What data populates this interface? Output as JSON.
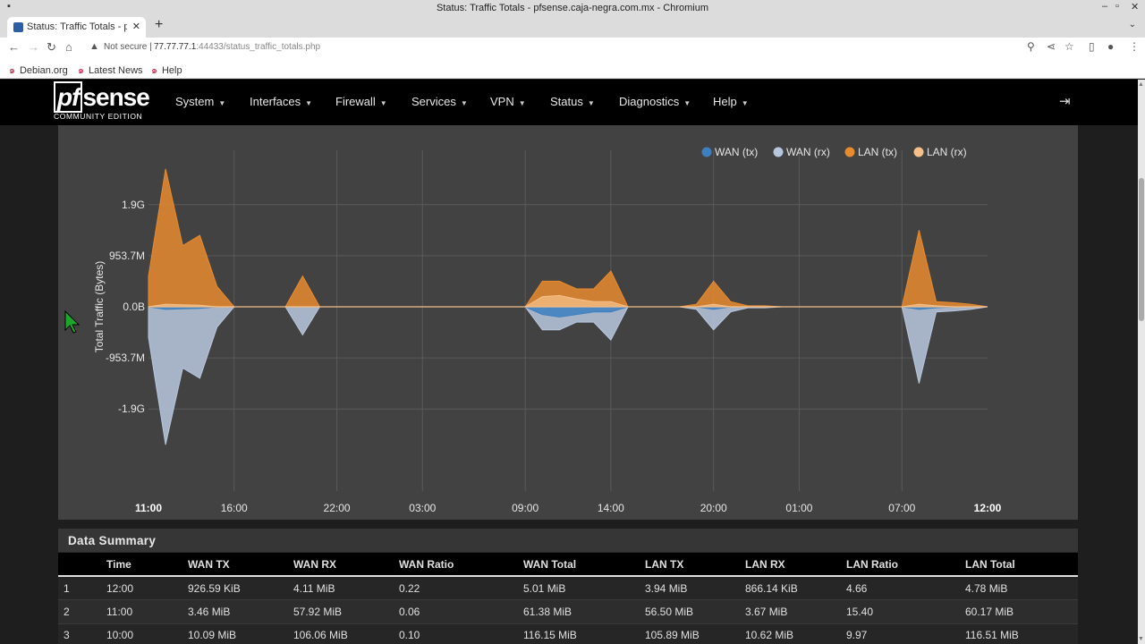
{
  "browser": {
    "window_title": "Status: Traffic Totals - pfsense.caja-negra.com.mx - Chromium",
    "tab_title": "Status: Traffic Totals - pfSense",
    "security_label": "Not secure",
    "url_host": "77.77.77.1",
    "url_rest": ":44433/status_traffic_totals.php",
    "bookmarks": [
      "Debian.org",
      "Latest News",
      "Help"
    ]
  },
  "navbar": {
    "logo_main": "sense",
    "logo_pf": "pf",
    "logo_edition": "COMMUNITY EDITION",
    "menu": [
      "System",
      "Interfaces",
      "Firewall",
      "Services",
      "VPN",
      "Status",
      "Diagnostics",
      "Help"
    ]
  },
  "chart_data": {
    "type": "area",
    "ylabel": "Total Traffic (Bytes)",
    "y_ticks": [
      "1.9G",
      "953.7M",
      "0.0B",
      "-953.7M",
      "-1.9G"
    ],
    "y_tick_values": [
      2.0,
      1.0,
      0.0,
      -1.0,
      -2.0
    ],
    "ylim": [
      -2.7,
      2.7
    ],
    "x_ticks": [
      "11:00",
      "16:00",
      "22:00",
      "03:00",
      "09:00",
      "14:00",
      "20:00",
      "01:00",
      "07:00",
      "12:00"
    ],
    "x_tick_positions": [
      0,
      5,
      11,
      16,
      22,
      27,
      33,
      38,
      44,
      49
    ],
    "x_bold_ticks": [
      "11:00",
      "12:00"
    ],
    "xlim": [
      0,
      49
    ],
    "grid": true,
    "legend": [
      "WAN (tx)",
      "WAN (rx)",
      "LAN (tx)",
      "LAN (rx)"
    ],
    "legend_position": "top-right",
    "colors": {
      "wan_tx": "#3d7fbf",
      "wan_rx": "#b8c7de",
      "lan_tx": "#e88a2e",
      "lan_rx": "#f5c08a"
    },
    "series": [
      {
        "name": "LAN (tx)",
        "x": [
          0,
          1,
          2,
          3,
          4,
          5,
          6,
          7,
          8,
          9,
          10,
          11,
          12,
          13,
          14,
          15,
          16,
          17,
          18,
          19,
          20,
          21,
          22,
          23,
          24,
          25,
          26,
          27,
          28,
          29,
          30,
          31,
          32,
          33,
          34,
          35,
          36,
          37,
          38,
          39,
          40,
          41,
          42,
          43,
          44,
          45,
          46,
          47,
          48,
          49
        ],
        "values": [
          0.6,
          2.7,
          1.2,
          1.4,
          0.4,
          0.0,
          0.0,
          0.0,
          0.0,
          0.6,
          0.0,
          0.0,
          0.0,
          0.0,
          0.0,
          0.0,
          0.0,
          0.0,
          0.0,
          0.0,
          0.0,
          0.0,
          0.0,
          0.5,
          0.5,
          0.35,
          0.35,
          0.7,
          0.0,
          0.0,
          0.0,
          0.0,
          0.05,
          0.5,
          0.1,
          0.02,
          0.02,
          0.0,
          0.0,
          0.0,
          0.0,
          0.0,
          0.0,
          0.0,
          0.0,
          1.5,
          0.1,
          0.08,
          0.05,
          0.0
        ]
      },
      {
        "name": "LAN (rx)",
        "x": [
          0,
          1,
          2,
          3,
          4,
          5,
          6,
          7,
          8,
          9,
          10,
          11,
          12,
          13,
          14,
          15,
          16,
          17,
          18,
          19,
          20,
          21,
          22,
          23,
          24,
          25,
          26,
          27,
          28,
          29,
          30,
          31,
          32,
          33,
          34,
          35,
          36,
          37,
          38,
          39,
          40,
          41,
          42,
          43,
          44,
          45,
          46,
          47,
          48,
          49
        ],
        "values": [
          0.0,
          0.05,
          0.04,
          0.03,
          0.0,
          0.0,
          0.0,
          0.0,
          0.0,
          0.0,
          0.0,
          0.0,
          0.0,
          0.0,
          0.0,
          0.0,
          0.0,
          0.0,
          0.0,
          0.0,
          0.0,
          0.0,
          0.0,
          0.2,
          0.22,
          0.15,
          0.1,
          0.1,
          0.0,
          0.0,
          0.0,
          0.0,
          0.0,
          0.05,
          0.0,
          0.0,
          0.0,
          0.0,
          0.0,
          0.0,
          0.0,
          0.0,
          0.0,
          0.0,
          0.0,
          0.05,
          0.02,
          0.0,
          0.0,
          0.0
        ]
      },
      {
        "name": "WAN (rx)",
        "x": [
          0,
          1,
          2,
          3,
          4,
          5,
          6,
          7,
          8,
          9,
          10,
          11,
          12,
          13,
          14,
          15,
          16,
          17,
          18,
          19,
          20,
          21,
          22,
          23,
          24,
          25,
          26,
          27,
          28,
          29,
          30,
          31,
          32,
          33,
          34,
          35,
          36,
          37,
          38,
          39,
          40,
          41,
          42,
          43,
          44,
          45,
          46,
          47,
          48,
          49
        ],
        "values": [
          -0.6,
          -2.7,
          -1.2,
          -1.4,
          -0.4,
          0.0,
          0.0,
          0.0,
          0.0,
          -0.55,
          0.0,
          0.0,
          0.0,
          0.0,
          0.0,
          0.0,
          0.0,
          0.0,
          0.0,
          0.0,
          0.0,
          0.0,
          0.0,
          -0.45,
          -0.45,
          -0.3,
          -0.3,
          -0.65,
          0.0,
          0.0,
          0.0,
          0.0,
          -0.05,
          -0.45,
          -0.1,
          -0.02,
          -0.02,
          0.0,
          0.0,
          0.0,
          0.0,
          0.0,
          0.0,
          0.0,
          0.0,
          -1.5,
          -0.1,
          -0.08,
          -0.05,
          0.0
        ]
      },
      {
        "name": "WAN (tx)",
        "x": [
          0,
          1,
          2,
          3,
          4,
          5,
          6,
          7,
          8,
          9,
          10,
          11,
          12,
          13,
          14,
          15,
          16,
          17,
          18,
          19,
          20,
          21,
          22,
          23,
          24,
          25,
          26,
          27,
          28,
          29,
          30,
          31,
          32,
          33,
          34,
          35,
          36,
          37,
          38,
          39,
          40,
          41,
          42,
          43,
          44,
          45,
          46,
          47,
          48,
          49
        ],
        "values": [
          0.0,
          -0.05,
          -0.04,
          -0.03,
          0.0,
          0.0,
          0.0,
          0.0,
          0.0,
          0.0,
          0.0,
          0.0,
          0.0,
          0.0,
          0.0,
          0.0,
          0.0,
          0.0,
          0.0,
          0.0,
          0.0,
          0.0,
          0.0,
          -0.15,
          -0.2,
          -0.15,
          -0.1,
          -0.1,
          0.0,
          0.0,
          0.0,
          0.0,
          0.0,
          -0.05,
          0.0,
          0.0,
          0.0,
          0.0,
          0.0,
          0.0,
          0.0,
          0.0,
          0.0,
          0.0,
          0.0,
          -0.05,
          -0.02,
          0.0,
          0.0,
          0.0
        ]
      }
    ]
  },
  "summary": {
    "title": "Data Summary",
    "columns": [
      "",
      "Time",
      "WAN TX",
      "WAN RX",
      "WAN Ratio",
      "WAN Total",
      "LAN TX",
      "LAN RX",
      "LAN Ratio",
      "LAN Total"
    ],
    "rows": [
      [
        "1",
        "12:00",
        "926.59 KiB",
        "4.11 MiB",
        "0.22",
        "5.01 MiB",
        "3.94 MiB",
        "866.14 KiB",
        "4.66",
        "4.78 MiB"
      ],
      [
        "2",
        "11:00",
        "3.46 MiB",
        "57.92 MiB",
        "0.06",
        "61.38 MiB",
        "56.50 MiB",
        "3.67 MiB",
        "15.40",
        "60.17 MiB"
      ],
      [
        "3",
        "10:00",
        "10.09 MiB",
        "106.06 MiB",
        "0.10",
        "116.15 MiB",
        "105.89 MiB",
        "10.62 MiB",
        "9.97",
        "116.51 MiB"
      ]
    ]
  }
}
